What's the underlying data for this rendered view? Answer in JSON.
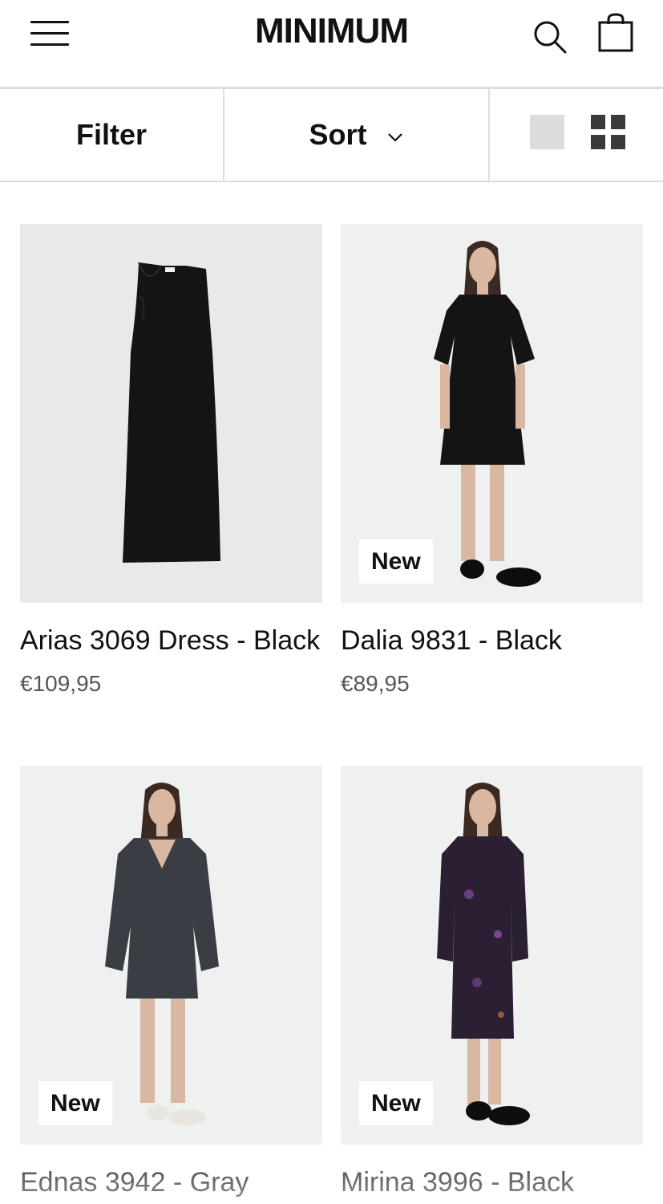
{
  "header": {
    "logo": "MINIMUM",
    "icons": [
      "menu-icon",
      "search-icon",
      "shopping-bag-icon"
    ]
  },
  "toolbar": {
    "filter_label": "Filter",
    "sort_label": "Sort",
    "sort_icon": "chevron-down-icon",
    "view_icons": [
      "single-view-icon",
      "grid-view-icon"
    ]
  },
  "products": [
    {
      "name": "Arias 3069 Dress - Black",
      "price": "€109,95",
      "badge": "",
      "bg": "#e9e9e9"
    },
    {
      "name": "Dalia 9831 - Black",
      "price": "€89,95",
      "badge": "New",
      "bg": "#eff0f0"
    },
    {
      "name": "Ednas 3942 - Gray",
      "price": "",
      "badge": "New",
      "bg": "#eff0f0"
    },
    {
      "name": "Mirina 3996 - Black",
      "price": "",
      "badge": "New",
      "bg": "#eff0f0"
    }
  ],
  "colors": {
    "text": "#111111",
    "price": "#555555",
    "divider": "#dcdcdc",
    "garment_black": "#141414",
    "garment_gray": "#3a3d44",
    "garment_print": "#2a1f33"
  }
}
